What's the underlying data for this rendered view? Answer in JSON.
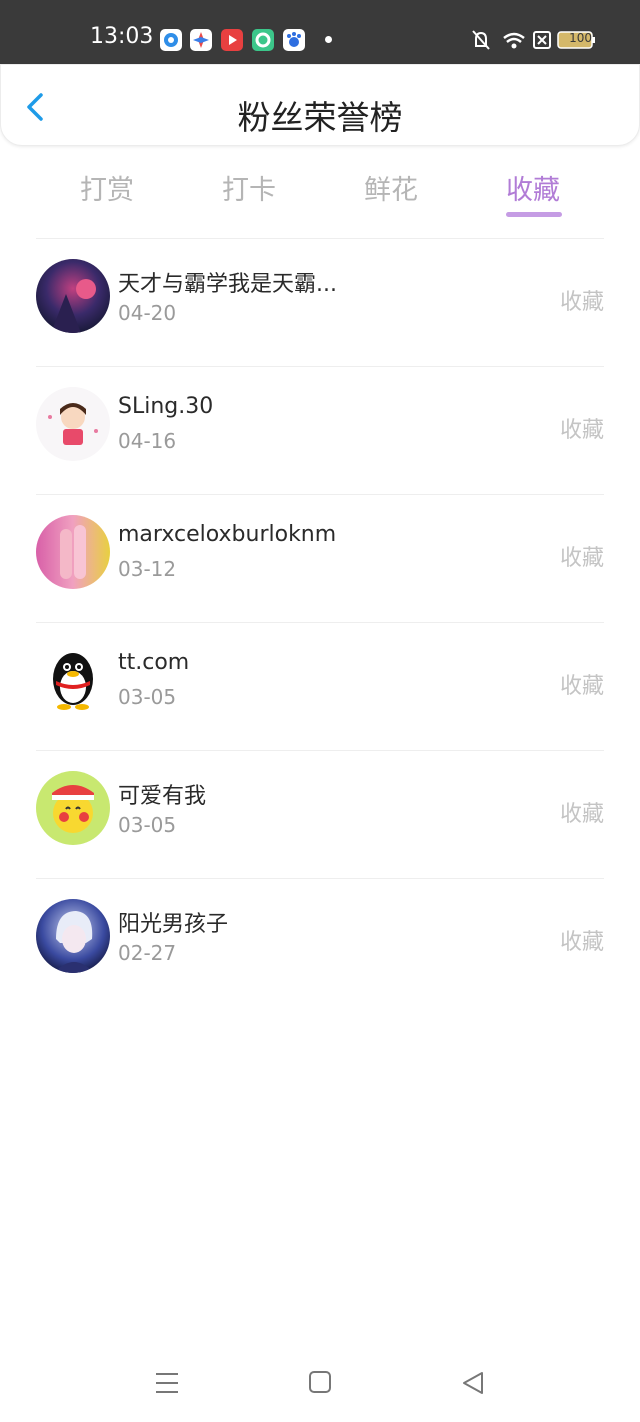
{
  "status_bar": {
    "time": "13:03",
    "battery": "100"
  },
  "header": {
    "title": "粉丝荣誉榜"
  },
  "tabs": [
    {
      "label": "打赏"
    },
    {
      "label": "打卡"
    },
    {
      "label": "鲜花"
    },
    {
      "label": "收藏"
    }
  ],
  "active_tab": "收藏",
  "fans": [
    {
      "name": "天才与霸学我是天霸...",
      "date": "04-20",
      "action": "收藏",
      "avatar_icon": "dark-character-avatar"
    },
    {
      "name": "SLing.30",
      "date": "04-16",
      "action": "收藏",
      "avatar_icon": "cartoon-boy-avatar"
    },
    {
      "name": "marxceloxburloknm",
      "date": "03-12",
      "action": "收藏",
      "avatar_icon": "pink-fingers-avatar"
    },
    {
      "name": "tt.com",
      "date": "03-05",
      "action": "收藏",
      "avatar_icon": "qq-penguin-avatar"
    },
    {
      "name": "可爱有我",
      "date": "03-05",
      "action": "收藏",
      "avatar_icon": "pikachu-avatar"
    },
    {
      "name": "阳光男孩子",
      "date": "02-27",
      "action": "收藏",
      "avatar_icon": "anime-boy-avatar"
    }
  ],
  "colors": {
    "accent": "#b17cd6",
    "back_arrow": "#1e9be8",
    "status_bar": "#3a3a3a"
  }
}
